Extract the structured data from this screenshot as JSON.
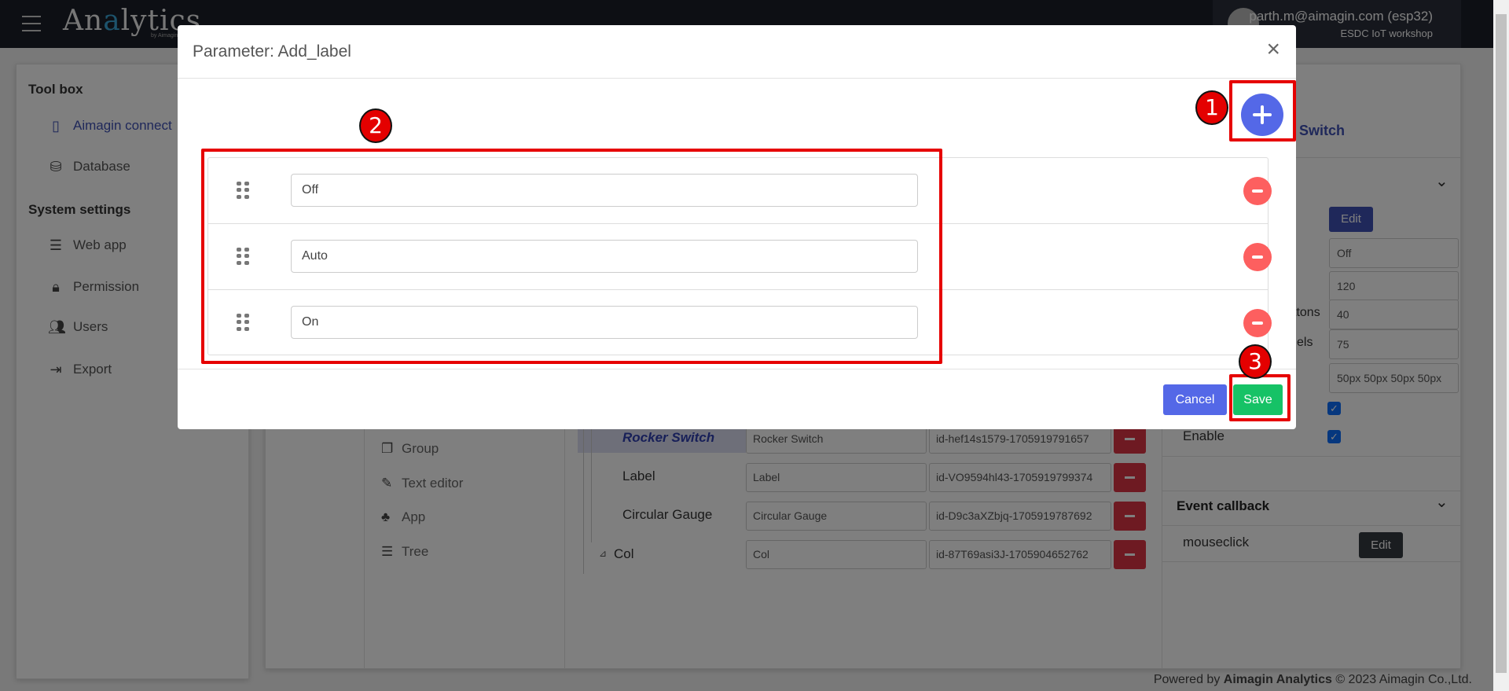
{
  "app": {
    "logo": "Analytics",
    "logo_sub": "by Aimagin",
    "user_email": "parth.m@aimagin.com (esp32)",
    "user_org": "ESDC IoT workshop"
  },
  "sidebar": {
    "toolbox_heading": "Tool box",
    "toolbox_items": [
      {
        "label": "Aimagin connect",
        "icon": "file-code-icon"
      },
      {
        "label": "Database",
        "icon": "database-icon"
      }
    ],
    "settings_heading": "System settings",
    "settings_items": [
      {
        "label": "Web app",
        "icon": "server-icon"
      },
      {
        "label": "Permission",
        "icon": "lock-icon"
      },
      {
        "label": "Users",
        "icon": "users-icon"
      },
      {
        "label": "Export",
        "icon": "export-icon"
      }
    ]
  },
  "tools": [
    {
      "label": "Group",
      "icon": "copy-icon"
    },
    {
      "label": "Text editor",
      "icon": "edit-icon"
    },
    {
      "label": "App",
      "icon": "sitemap-icon"
    },
    {
      "label": "Tree",
      "icon": "list-icon"
    }
  ],
  "tree": [
    {
      "label": "Rocker Switch",
      "name": "Rocker Switch",
      "id": "id-hef14s1579-1705919791657",
      "selected": true
    },
    {
      "label": "Label",
      "name": "Label",
      "id": "id-VO9594hl43-1705919799374"
    },
    {
      "label": "Circular Gauge",
      "name": "Circular Gauge",
      "id": "id-D9c3aXZbjq-1705919787692"
    },
    {
      "label": "Col",
      "name": "Col",
      "id": "id-87T69asi3J-1705904652762",
      "toggle": "⊿"
    }
  ],
  "props": {
    "header": "Switch",
    "edit_label": "Edit",
    "values": [
      "Off",
      "120",
      "40",
      "75",
      "50px 50px 50px 50px"
    ],
    "label_fragments": {
      "buttons": "ttons",
      "labels": "els"
    },
    "enable_label": "Enable",
    "event_heading": "Event callback",
    "event_name": "mouseclick",
    "event_edit": "Edit"
  },
  "footer": {
    "prefix": "Powered by ",
    "brand": "Aimagin Analytics",
    "suffix": " © 2023 Aimagin Co.,Ltd."
  },
  "dialog": {
    "title": "Parameter: Add_label",
    "close": "×",
    "options": [
      "Off",
      "Auto",
      "On"
    ],
    "cancel": "Cancel",
    "save": "Save"
  },
  "annotations": [
    "1",
    "2",
    "3"
  ],
  "colors": {
    "primary": "#5468e7",
    "danger": "#fd5f5f",
    "success": "#16c266",
    "annotation": "#e60000"
  }
}
